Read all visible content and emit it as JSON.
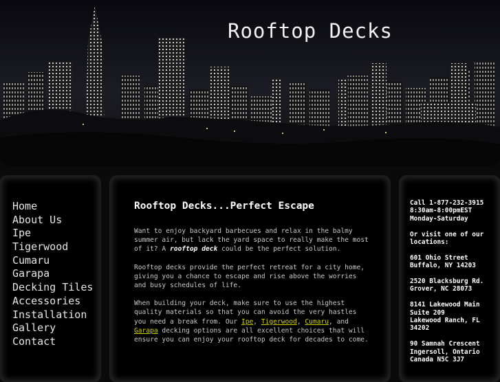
{
  "header": {
    "title": "Rooftop Decks"
  },
  "nav": {
    "items": [
      {
        "label": "Home"
      },
      {
        "label": "About Us"
      },
      {
        "label": "Ipe"
      },
      {
        "label": "Tigerwood"
      },
      {
        "label": "Cumaru"
      },
      {
        "label": "Garapa"
      },
      {
        "label": "Decking Tiles"
      },
      {
        "label": "Accessories"
      },
      {
        "label": "Installation"
      },
      {
        "label": "Gallery"
      },
      {
        "label": "Contact"
      }
    ]
  },
  "main": {
    "heading": "Rooftop Decks...Perfect Escape",
    "p1": {
      "text_before": "Want to enjoy backyard barbecues and relax in the balmy summer air, but lack the yard space to really make the most of it? A ",
      "emphasis": "rooftop deck",
      "text_after": " could be the perfect solution."
    },
    "p2": "Rooftop decks provide the perfect retreat for a city home, giving you a chance to escape and rise above the worries and busy schedules of life.",
    "p3": {
      "text_before": "When building your deck, make sure to use the highest quality materials so that you can avoid the very hastles you need a break from. Our ",
      "link_ipe": "Ipe",
      "sep1": ", ",
      "link_tigerwood": "Tigerwood",
      "sep2": ", ",
      "link_cumaru": "Cumaru",
      "sep3": ", and ",
      "link_garapa": "Garapa",
      "text_after": " decking options are all excellent choices that will ensure you can enjoy your rooftop deck for decades to come."
    }
  },
  "contact": {
    "phone": "Call 1-877-232-3915",
    "hours": "8:30am-8:00pmEST",
    "days": "Monday-Saturday",
    "visit_line1": "Or visit one of our",
    "visit_line2": "locations:",
    "locations": [
      {
        "line1": "601 Ohio Street",
        "line2": "Buffalo, NY 14203"
      },
      {
        "line1": "2520 Blacksburg Rd.",
        "line2": "Grover, NC 28073"
      },
      {
        "line1": "8141 Lakewood Main",
        "line2": "Suite 209",
        "line3": "Lakewood Ranch, FL",
        "line4": "34202"
      },
      {
        "line1": "90 Samnah Crescent",
        "line2": "Ingersoll, Ontario",
        "line3": "Canada N5C 3J7"
      }
    ]
  },
  "colors": {
    "link_highlight": "#d4d400",
    "background": "#000000",
    "text": "#c9c9c9"
  }
}
